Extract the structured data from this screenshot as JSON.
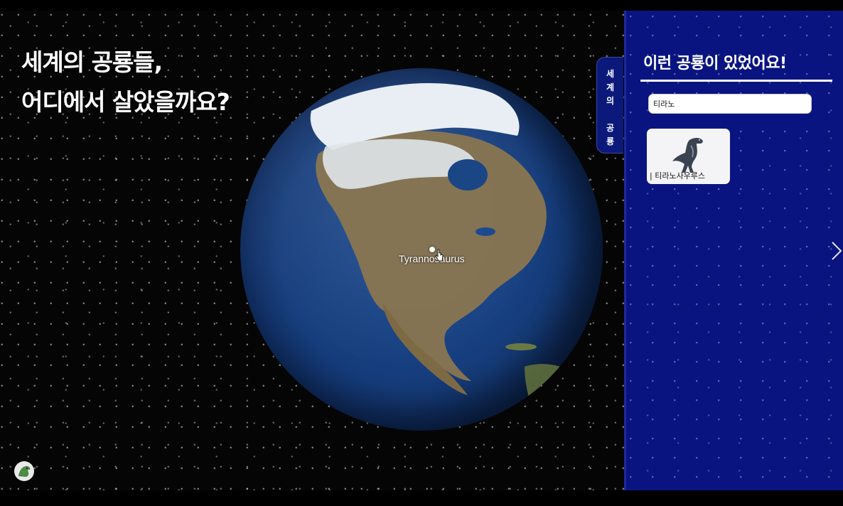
{
  "headline": {
    "line1": "세계의 공룡들,",
    "line2": "어디에서 살았을까요?"
  },
  "globe": {
    "marker_label": "Tyrannosaurus"
  },
  "side_tab": {
    "chars": [
      "세",
      "계",
      "의",
      "",
      "공",
      "룡"
    ]
  },
  "panel": {
    "title": "이런 공룡이 있었어요!",
    "search_value": "티라노",
    "results": [
      {
        "label": "| 티라노사우루스"
      }
    ]
  },
  "colors": {
    "panel_bg": "#0a1480",
    "ocean": "#163d7c",
    "land": "#8a7650",
    "ice": "#e8eef3"
  },
  "icons": {
    "next": "chevron-right-icon",
    "logo": "dinosaur-logo-icon",
    "cursor": "pointer-cursor-icon"
  }
}
